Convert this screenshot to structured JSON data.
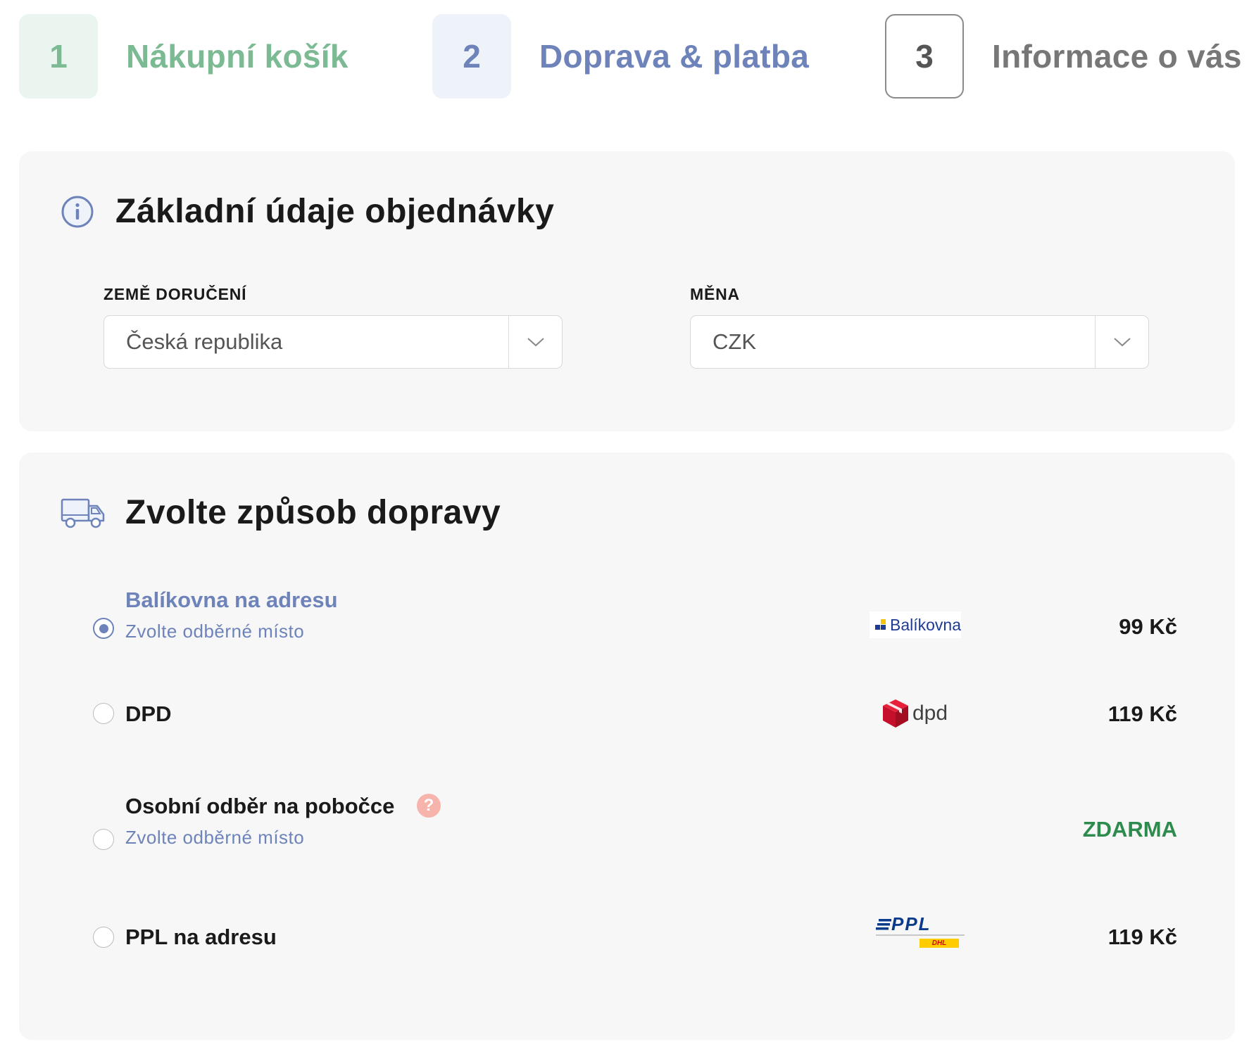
{
  "stepper": [
    {
      "number": "1",
      "label": "Nákupní košík",
      "state": "done"
    },
    {
      "number": "2",
      "label": "Doprava & platba",
      "state": "active"
    },
    {
      "number": "3",
      "label": "Informace o vás",
      "state": "pending"
    }
  ],
  "basic_info": {
    "title": "Základní údaje objednávky",
    "icon": "info-icon",
    "country": {
      "label": "ZEMĚ DORUČENÍ",
      "value": "Česká republika"
    },
    "currency": {
      "label": "MĚNA",
      "value": "CZK"
    }
  },
  "shipping": {
    "title": "Zvolte způsob dopravy",
    "icon": "truck-icon",
    "options": [
      {
        "name": "Balíkovna na adresu",
        "subtitle": "Zvolte odběrné místo",
        "logo_text": "Balíkovna",
        "price": "99 Kč",
        "selected": true
      },
      {
        "name": "DPD",
        "logo_text": "dpd",
        "price": "119 Kč",
        "selected": false
      },
      {
        "name": "Osobní odběr na pobočce",
        "subtitle": "Zvolte odběrné místo",
        "help": "?",
        "price": "ZDARMA",
        "selected": false
      },
      {
        "name": "PPL na adresu",
        "logo_text": "PPL",
        "logo_subtext": "DHL",
        "price": "119 Kč",
        "selected": false
      }
    ]
  },
  "colors": {
    "done": "#7bba92",
    "active": "#6d83b9",
    "pending": "#777777",
    "free_price": "#2e8b4e",
    "card_bg": "#f7f7f7",
    "help_icon": "#f7b4ad"
  }
}
